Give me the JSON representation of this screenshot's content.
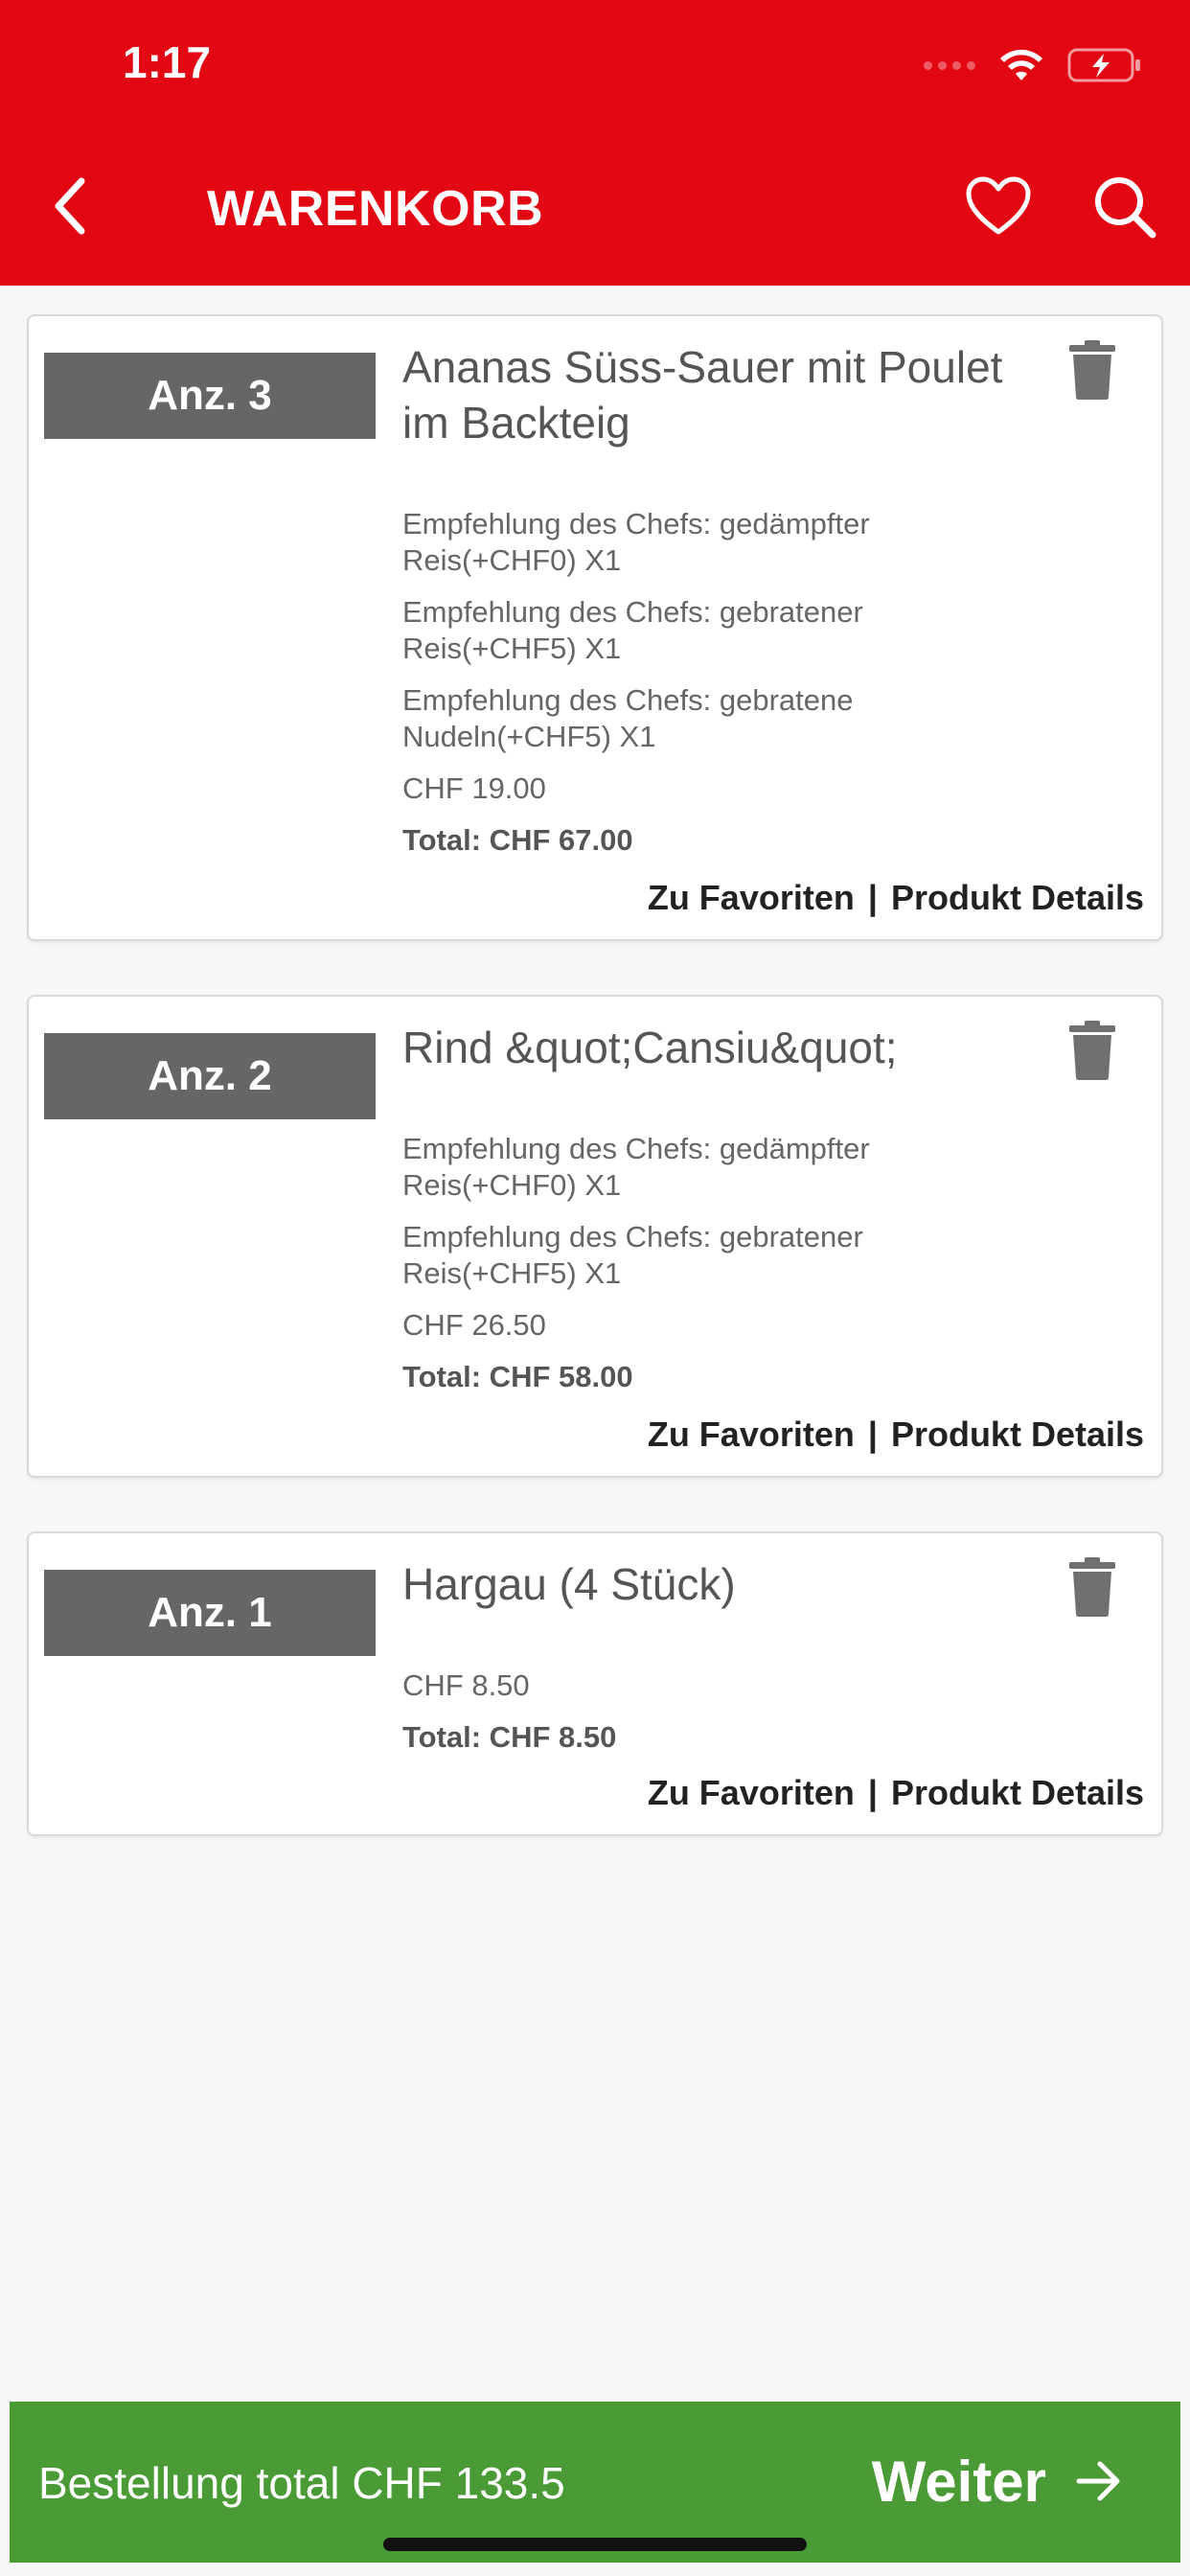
{
  "status_bar": {
    "time": "1:17"
  },
  "header": {
    "title": "WARENKORB"
  },
  "icons": {
    "back": "chevron-left-icon",
    "favorite": "heart-outline-icon",
    "search": "search-icon",
    "trash": "trash-icon",
    "arrow": "arrow-right-icon"
  },
  "colors": {
    "brand_red": "#e30613",
    "confirm_green": "#4a9a36",
    "qty_gray": "#666666"
  },
  "cart": {
    "items": [
      {
        "qty": "Anz. 3",
        "name": "Ananas Süss-Sauer mit Poulet im Backteig",
        "options": [
          "Empfehlung des Chefs: gedämpfter Reis(+CHF0) X1",
          "Empfehlung des Chefs: gebratener Reis(+CHF5) X1",
          "Empfehlung des Chefs: gebratene Nudeln(+CHF5) X1"
        ],
        "price": "CHF 19.00",
        "total": "Total: CHF 67.00",
        "fav_link": "Zu Favoriten",
        "separator": "|",
        "details_link": "Produkt Details"
      },
      {
        "qty": "Anz. 2",
        "name": "Rind &quot;Cansiu&quot;",
        "options": [
          "Empfehlung des Chefs: gedämpfter Reis(+CHF0) X1",
          "Empfehlung des Chefs: gebratener Reis(+CHF5) X1"
        ],
        "price": "CHF 26.50",
        "total": "Total: CHF 58.00",
        "fav_link": "Zu Favoriten",
        "separator": "|",
        "details_link": "Produkt Details"
      },
      {
        "qty": "Anz. 1",
        "name": "Hargau (4 Stück)",
        "options": [],
        "price": "CHF 8.50",
        "total": "Total: CHF 8.50",
        "fav_link": "Zu Favoriten",
        "separator": "|",
        "details_link": "Produkt Details"
      }
    ]
  },
  "footer": {
    "order_total": "Bestellung total CHF 133.5",
    "next_label": "Weiter"
  }
}
